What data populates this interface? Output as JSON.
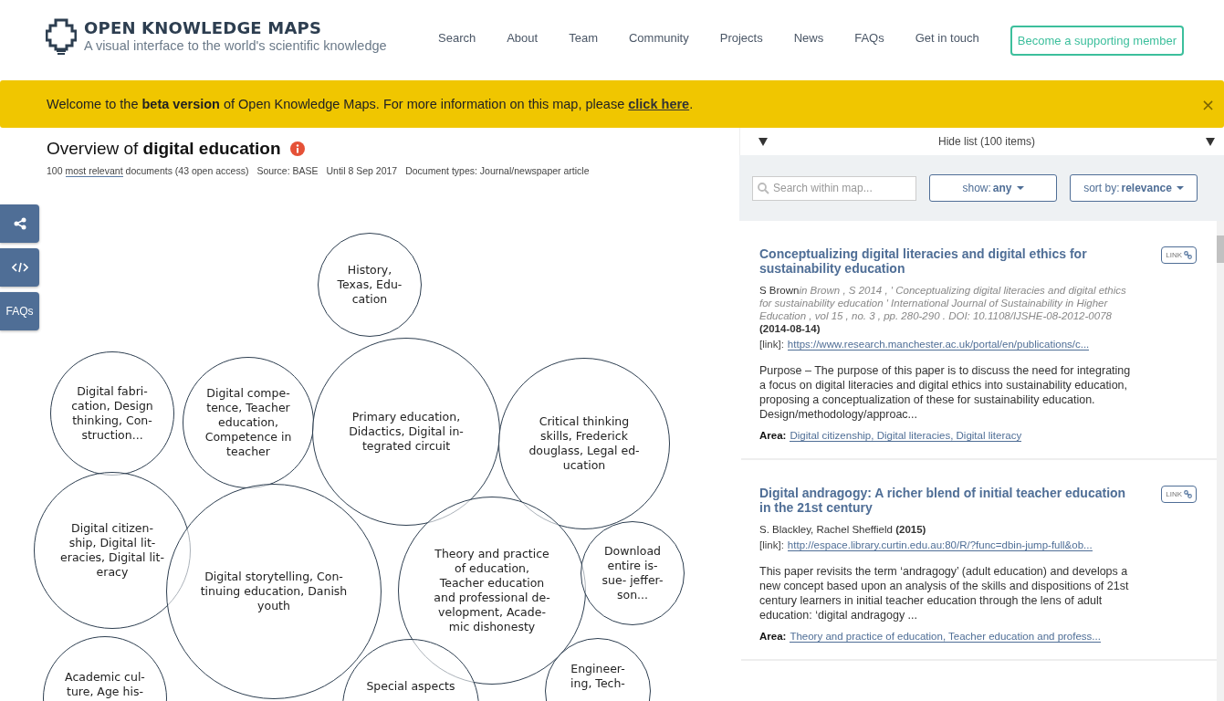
{
  "header": {
    "logo_title": "OPEN KNOWLEDGE MAPS",
    "logo_subtitle": "A visual interface to the world's scientific knowledge",
    "nav": [
      "Search",
      "About",
      "Team",
      "Community",
      "Projects",
      "News",
      "FAQs",
      "Get in touch"
    ],
    "cta": "Become a supporting member"
  },
  "banner": {
    "text": "Welcome to the **beta version** of Open Knowledge Maps. For more information on this map, please ",
    "link": "click here",
    "after": ".",
    "close": "×"
  },
  "overview": {
    "prefix": "Overview of ",
    "query": "digital education",
    "count": "100",
    "most_relevant": "most relevant",
    "rest": "documents (43 open access)",
    "source": "Source: BASE",
    "until": "Until 8 Sep 2017",
    "types": "Document types: Journal/newspaper article"
  },
  "side_buttons": [
    {
      "kind": "share"
    },
    {
      "kind": "embed"
    },
    {
      "kind": "text",
      "label": "FAQs"
    }
  ],
  "bubbles": [
    {
      "lines": [
        "History,",
        "Texas, Edu-",
        "cation"
      ]
    },
    {
      "lines": [
        "Digital fabri-",
        "cation, Design",
        "thinking, Con-",
        "struction..."
      ]
    },
    {
      "lines": [
        "Digital compe-",
        "tence, Teacher",
        "education,",
        "Competence in",
        "teacher"
      ]
    },
    {
      "lines": [
        "Primary education,",
        "Didactics, Digital in-",
        "tegrated circuit"
      ]
    },
    {
      "lines": [
        "Critical thinking",
        "skills, Frederick",
        "douglass, Legal ed-",
        "ucation"
      ]
    },
    {
      "lines": [
        "Digital citizen-",
        "ship, Digital lit-",
        "eracies, Digital lit-",
        "eracy"
      ]
    },
    {
      "lines": [
        "Digital storytelling, Con-",
        "tinuing education, Danish",
        "youth"
      ]
    },
    {
      "lines": [
        "Theory and practice",
        "of education,",
        "Teacher education",
        "and professional de-",
        "velopment, Acade-",
        "mic dishonesty"
      ]
    },
    {
      "lines": [
        "Download",
        "entire is-",
        "sue- jeffer-",
        "son..."
      ]
    },
    {
      "lines": [
        "Academic cul-",
        "ture, Age his-"
      ]
    },
    {
      "lines": [
        "Special aspects"
      ]
    },
    {
      "lines": [
        "Engineer-",
        "ing, Tech-"
      ]
    }
  ],
  "list": {
    "toggle": "Hide list (100 items)",
    "search_placeholder": "Search within map...",
    "show_label": "show: ",
    "show_value": "any",
    "sort_label": "sort by: ",
    "sort_value": "relevance",
    "items": [
      {
        "title": "Conceptualizing digital literacies and digital ethics for sustainability education",
        "link_button": "LINK",
        "authors": "S Brown",
        "in": "in",
        "source": "Brown , S 2014 , ' Conceptualizing digital literacies and digital ethics for sustainability education ' International Journal of Sustainability in Higher Education , vol 15 , no. 3 , pp. 280-290 . DOI: 10.1108/IJSHE-08-2012-0078",
        "date": "(2014-08-14)",
        "link_label": "[link]:",
        "url": "https://www.research.manchester.ac.uk/portal/en/publications/c...",
        "abstract": "Purpose – The purpose of this paper is to discuss the need for integrating a focus on digital literacies and digital ethics into sustainability education, proposing a conceptualization of these for sustainability education. Design/methodology/approac...",
        "area_label": "Area:",
        "area": "Digital citizenship, Digital literacies, Digital literacy"
      },
      {
        "title": "Digital andragogy: A richer blend of initial teacher education in the 21st century",
        "link_button": "LINK",
        "authors": "S. Blackley, Rachel Sheffield",
        "date": "(2015)",
        "link_label": "[link]:",
        "url": "http://espace.library.curtin.edu.au:80/R/?func=dbin-jump-full&ob...",
        "abstract": "This paper revisits the term ‘andragogy’ (adult education) and develops a new concept based upon an analysis of the skills and dispositions of 21st century learners in initial teacher education through the lens of adult education: ‘digital andragogy ...",
        "area_label": "Area:",
        "area": "Theory and practice of education, Teacher education and profess..."
      }
    ]
  }
}
